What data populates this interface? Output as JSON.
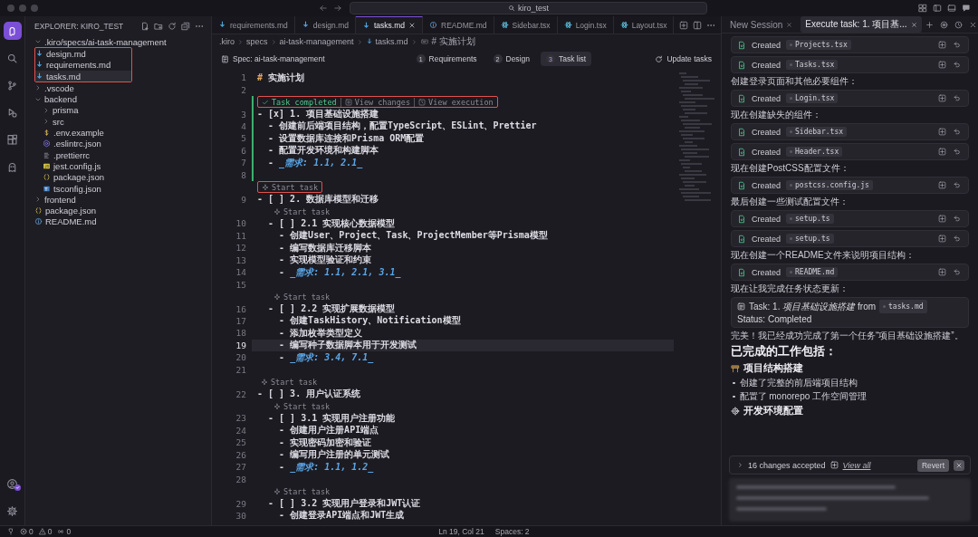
{
  "titlebar": {
    "search": "kiro_test"
  },
  "activity": [
    {
      "kind": "kiro",
      "selected": true
    },
    {
      "kind": "search",
      "selected": false
    },
    {
      "kind": "source-control",
      "selected": false
    },
    {
      "kind": "debug",
      "selected": false
    },
    {
      "kind": "extensions",
      "selected": false
    },
    {
      "kind": "ghost",
      "selected": false
    }
  ],
  "explorer": {
    "title": "EXPLORER: KIRO_TEST",
    "tree": [
      {
        "label": ".kiro/specs/ai-task-management",
        "kind": "folder",
        "expanded": true,
        "selected": false,
        "highlighted": true,
        "children": [
          {
            "label": "design.md",
            "kind": "md",
            "selected": false
          },
          {
            "label": "requirements.md",
            "kind": "md",
            "selected": false
          },
          {
            "label": "tasks.md",
            "kind": "md",
            "selected": true
          }
        ]
      },
      {
        "label": ".vscode",
        "kind": "folder",
        "expanded": false,
        "selected": false,
        "highlighted": false
      },
      {
        "label": "backend",
        "kind": "folder",
        "expanded": true,
        "selected": false,
        "highlighted": false,
        "children": [
          {
            "label": "prisma",
            "kind": "folder",
            "expanded": false,
            "selected": false,
            "highlighted": false
          },
          {
            "label": "src",
            "kind": "folder",
            "expanded": false,
            "selected": false,
            "highlighted": false
          },
          {
            "label": ".env.example",
            "kind": "env",
            "selected": false
          },
          {
            "label": ".eslintrc.json",
            "kind": "eslint",
            "selected": false
          },
          {
            "label": ".prettierrc",
            "kind": "prettier",
            "selected": false
          },
          {
            "label": "jest.config.js",
            "kind": "js",
            "selected": false
          },
          {
            "label": "package.json",
            "kind": "json",
            "selected": false
          },
          {
            "label": "tsconfig.json",
            "kind": "ts",
            "selected": false
          }
        ]
      },
      {
        "label": "frontend",
        "kind": "folder",
        "expanded": false,
        "selected": false,
        "highlighted": false
      },
      {
        "label": "package.json",
        "kind": "json",
        "selected": false
      },
      {
        "label": "README.md",
        "kind": "info",
        "selected": false
      }
    ]
  },
  "editor": {
    "tabs": [
      {
        "label": "requirements.md",
        "kind": "md",
        "selected": false
      },
      {
        "label": "design.md",
        "kind": "md",
        "selected": false
      },
      {
        "label": "tasks.md",
        "kind": "md",
        "selected": true
      },
      {
        "label": "README.md",
        "kind": "info",
        "selected": false
      },
      {
        "label": "Sidebar.tsx",
        "kind": "react",
        "selected": false
      },
      {
        "label": "Login.tsx",
        "kind": "react",
        "selected": false
      },
      {
        "label": "Layout.tsx",
        "kind": "react",
        "selected": false
      }
    ],
    "breadcrumbs": [
      {
        "label": ".kiro",
        "kind": "plain"
      },
      {
        "label": "specs",
        "kind": "plain"
      },
      {
        "label": "ai-task-management",
        "kind": "plain"
      },
      {
        "label": "tasks.md",
        "kind": "md"
      },
      {
        "label": "# 实施计划",
        "kind": "symbol"
      }
    ],
    "spec": {
      "title": "Spec: ai-task-management",
      "steps": [
        {
          "number": "1",
          "label": "Requirements",
          "selected": false
        },
        {
          "number": "2",
          "label": "Design",
          "selected": false
        },
        {
          "number": "3",
          "label": "Task list",
          "selected": true
        }
      ],
      "update": "Update tasks"
    },
    "rows": [
      {
        "kind": "heading",
        "n": "1",
        "marker": "#",
        "text": "实施计划",
        "added": false,
        "current": false
      },
      {
        "kind": "text",
        "n": "2",
        "added": false,
        "current": false
      },
      {
        "kind": "lens",
        "inner": false,
        "highlighted": true,
        "added": true,
        "items": [
          {
            "kind": "done",
            "label": "Task completed"
          },
          {
            "kind": "changes",
            "label": "View changes"
          },
          {
            "kind": "execution",
            "label": "View execution"
          }
        ]
      },
      {
        "kind": "text",
        "n": "3",
        "text": "- [x] 1. 项目基础设施搭建",
        "added": true,
        "current": false
      },
      {
        "kind": "text",
        "n": "4",
        "text": "  - 创建前后端项目结构，配置TypeScript、ESLint、Prettier",
        "added": true,
        "current": false
      },
      {
        "kind": "text",
        "n": "5",
        "text": "  - 设置数据库连接和Prisma ORM配置",
        "added": true,
        "current": false
      },
      {
        "kind": "text",
        "n": "6",
        "text": "  - 配置开发环境和构建脚本",
        "added": true,
        "current": false
      },
      {
        "kind": "ref",
        "n": "7",
        "text": "  - ",
        "ref": "_需求: 1.1, 2.1_",
        "added": true,
        "current": false
      },
      {
        "kind": "text",
        "n": "8",
        "added": true,
        "current": false
      },
      {
        "kind": "lens",
        "inner": false,
        "highlighted": true,
        "added": false,
        "items": [
          {
            "kind": "start",
            "label": "Start task"
          }
        ]
      },
      {
        "kind": "text",
        "n": "9",
        "text": "- [ ] 2. 数据库模型和迁移",
        "added": false,
        "current": false
      },
      {
        "kind": "lens",
        "inner": true,
        "highlighted": false,
        "added": false,
        "items": [
          {
            "kind": "start",
            "label": "Start task"
          }
        ]
      },
      {
        "kind": "text",
        "n": "10",
        "text": "  - [ ] 2.1 实现核心数据模型",
        "added": false,
        "current": false
      },
      {
        "kind": "text",
        "n": "11",
        "text": "    - 创建User、Project、Task、ProjectMember等Prisma模型",
        "added": false,
        "current": false
      },
      {
        "kind": "text",
        "n": "12",
        "text": "    - 编写数据库迁移脚本",
        "added": false,
        "current": false
      },
      {
        "kind": "text",
        "n": "13",
        "text": "    - 实现模型验证和约束",
        "added": false,
        "current": false
      },
      {
        "kind": "ref",
        "n": "14",
        "text": "    - ",
        "ref": "_需求: 1.1, 2.1, 3.1_",
        "added": false,
        "current": false
      },
      {
        "kind": "text",
        "n": "15",
        "added": false,
        "current": false
      },
      {
        "kind": "lens",
        "inner": true,
        "highlighted": false,
        "added": false,
        "items": [
          {
            "kind": "start",
            "label": "Start task"
          }
        ]
      },
      {
        "kind": "text",
        "n": "16",
        "text": "  - [ ] 2.2 实现扩展数据模型",
        "added": false,
        "current": false
      },
      {
        "kind": "text",
        "n": "17",
        "text": "    - 创建TaskHistory、Notification模型",
        "added": false,
        "current": false
      },
      {
        "kind": "text",
        "n": "18",
        "text": "    - 添加枚举类型定义",
        "added": false,
        "current": false
      },
      {
        "kind": "text",
        "n": "19",
        "text": "    - 编写种子数据脚本用于开发测试",
        "added": false,
        "current": true
      },
      {
        "kind": "ref",
        "n": "20",
        "text": "    - ",
        "ref": "_需求: 3.4, 7.1_",
        "added": false,
        "current": false
      },
      {
        "kind": "text",
        "n": "21",
        "added": false,
        "current": false
      },
      {
        "kind": "lens",
        "inner": false,
        "highlighted": false,
        "added": false,
        "items": [
          {
            "kind": "start",
            "label": "Start task"
          }
        ]
      },
      {
        "kind": "text",
        "n": "22",
        "text": "- [ ] 3. 用户认证系统",
        "added": false,
        "current": false
      },
      {
        "kind": "lens",
        "inner": true,
        "highlighted": false,
        "added": false,
        "items": [
          {
            "kind": "start",
            "label": "Start task"
          }
        ]
      },
      {
        "kind": "text",
        "n": "23",
        "text": "  - [ ] 3.1 实现用户注册功能",
        "added": false,
        "current": false
      },
      {
        "kind": "text",
        "n": "24",
        "text": "    - 创建用户注册API端点",
        "added": false,
        "current": false
      },
      {
        "kind": "text",
        "n": "25",
        "text": "    - 实现密码加密和验证",
        "added": false,
        "current": false
      },
      {
        "kind": "text",
        "n": "26",
        "text": "    - 编写用户注册的单元测试",
        "added": false,
        "current": false
      },
      {
        "kind": "ref",
        "n": "27",
        "text": "    - ",
        "ref": "_需求: 1.1, 1.2_",
        "added": false,
        "current": false
      },
      {
        "kind": "text",
        "n": "28",
        "added": false,
        "current": false
      },
      {
        "kind": "lens",
        "inner": true,
        "highlighted": false,
        "added": false,
        "items": [
          {
            "kind": "start",
            "label": "Start task"
          }
        ]
      },
      {
        "kind": "text",
        "n": "29",
        "text": "  - [ ] 3.2 实现用户登录和JWT认证",
        "added": false,
        "current": false
      },
      {
        "kind": "text",
        "n": "30",
        "text": "    - 创建登录API端点和JWT生成",
        "added": false,
        "current": false
      }
    ]
  },
  "chat": {
    "tabs": [
      {
        "label": "New Session",
        "selected": false
      },
      {
        "label": "Execute task: 1. 项目基...",
        "selected": true
      }
    ],
    "messages": [
      {
        "kind": "created",
        "label": "Created",
        "file": "Projects.tsx"
      },
      {
        "kind": "created",
        "label": "Created",
        "file": "Tasks.tsx"
      },
      {
        "kind": "text",
        "text": "创建登录页面和其他必要组件："
      },
      {
        "kind": "created",
        "label": "Created",
        "file": "Login.tsx"
      },
      {
        "kind": "text",
        "text": "现在创建缺失的组件："
      },
      {
        "kind": "created",
        "label": "Created",
        "file": "Sidebar.tsx"
      },
      {
        "kind": "created",
        "label": "Created",
        "file": "Header.tsx"
      },
      {
        "kind": "text",
        "text": "现在创建PostCSS配置文件："
      },
      {
        "kind": "created",
        "label": "Created",
        "file": "postcss.config.js"
      },
      {
        "kind": "text",
        "text": "最后创建一些测试配置文件："
      },
      {
        "kind": "created",
        "label": "Created",
        "file": "setup.ts"
      },
      {
        "kind": "created",
        "label": "Created",
        "file": "setup.ts"
      },
      {
        "kind": "text",
        "text": "现在创建一个README文件来说明项目结构："
      },
      {
        "kind": "created",
        "label": "Created",
        "file": "README.md"
      },
      {
        "kind": "text",
        "text": "现在让我完成任务状态更新："
      },
      {
        "kind": "task",
        "title": "Task: 1. *项目基础设施搭建* from",
        "file": "tasks.md",
        "status": "Status: Completed"
      },
      {
        "kind": "text",
        "text": "完美！我已经成功完成了第一个任务“项目基础设施搭建”。"
      },
      {
        "kind": "heading",
        "text": "已完成的工作包括："
      },
      {
        "kind": "structure",
        "text": "项目结构搭建"
      },
      {
        "kind": "bullet",
        "text": "创建了完整的前后端项目结构"
      },
      {
        "kind": "bullet",
        "text": "配置了 monorepo 工作空间管理"
      },
      {
        "kind": "environment",
        "text": "开发环境配置"
      }
    ],
    "changes": {
      "summary": "16 changes accepted",
      "link": "View all",
      "revert": "Revert"
    }
  },
  "status": {
    "left": [
      {
        "kind": "errors",
        "text": "0"
      },
      {
        "kind": "warnings",
        "text": "0"
      },
      {
        "kind": "ports",
        "text": "0"
      }
    ],
    "right": [
      "Ln 19, Col 21",
      "Spaces: 2"
    ]
  }
}
